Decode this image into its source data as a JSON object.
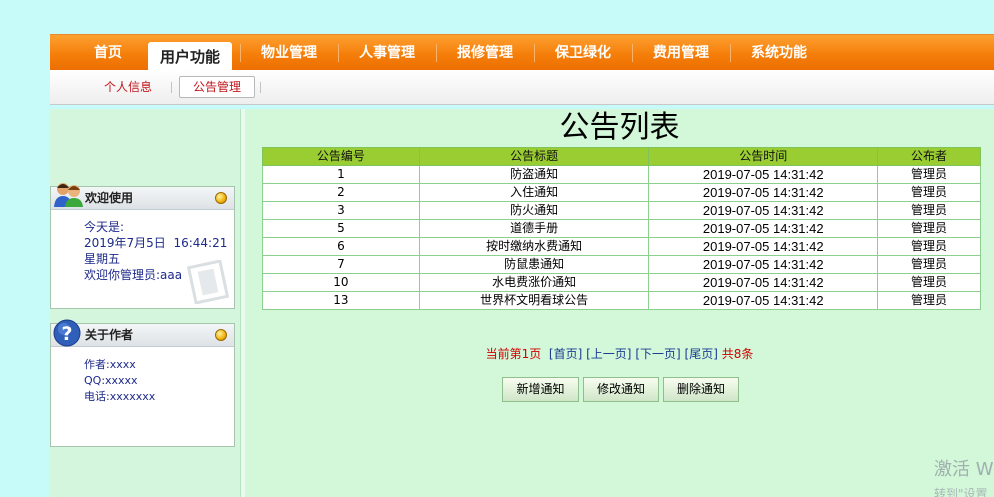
{
  "top_nav": {
    "items": [
      "首页",
      "用户功能",
      "物业管理",
      "人事管理",
      "报修管理",
      "保卫绿化",
      "费用管理",
      "系统功能"
    ],
    "active_index": 1
  },
  "sub_nav": {
    "items": [
      "个人信息",
      "公告管理"
    ],
    "active_index": 1
  },
  "welcome_box": {
    "title": "欢迎使用",
    "today_label": "今天是:",
    "date": "2019年7月5日",
    "time": "16:44:21",
    "weekday": "星期五",
    "welcome_text": "欢迎你管理员:aaa"
  },
  "about_box": {
    "title": "关于作者",
    "author": "作者:xxxx",
    "qq": "QQ:xxxxx",
    "phone": "电话:xxxxxxx"
  },
  "main": {
    "title": "公告列表",
    "columns": [
      "公告编号",
      "公告标题",
      "公告时间",
      "公布者"
    ],
    "rows": [
      [
        "1",
        "防盗通知",
        "2019-07-05 14:31:42",
        "管理员"
      ],
      [
        "2",
        "入住通知",
        "2019-07-05 14:31:42",
        "管理员"
      ],
      [
        "3",
        "防火通知",
        "2019-07-05 14:31:42",
        "管理员"
      ],
      [
        "5",
        "道德手册",
        "2019-07-05 14:31:42",
        "管理员"
      ],
      [
        "6",
        "按时缴纳水费通知",
        "2019-07-05 14:31:42",
        "管理员"
      ],
      [
        "7",
        "防鼠患通知",
        "2019-07-05 14:31:42",
        "管理员"
      ],
      [
        "10",
        "水电费涨价通知",
        "2019-07-05 14:31:42",
        "管理员"
      ],
      [
        "13",
        "世界杯文明看球公告",
        "2019-07-05 14:31:42",
        "管理员"
      ]
    ],
    "pager": {
      "current": "当前第1页",
      "first": "[首页]",
      "prev": "[上一页]",
      "next": "[下一页]",
      "last": "[尾页]",
      "total": "共8条"
    },
    "buttons": {
      "add": "新增通知",
      "edit": "修改通知",
      "delete": "删除通知"
    }
  },
  "watermark": {
    "line1": "激活 W",
    "line2": "转到\"设置"
  },
  "colors": {
    "nav_orange": "#f57e09",
    "header_green": "#9acd32",
    "content_bg": "#d2f7d9",
    "page_bg": "#c6fbfa",
    "link_red": "#c0161c"
  }
}
